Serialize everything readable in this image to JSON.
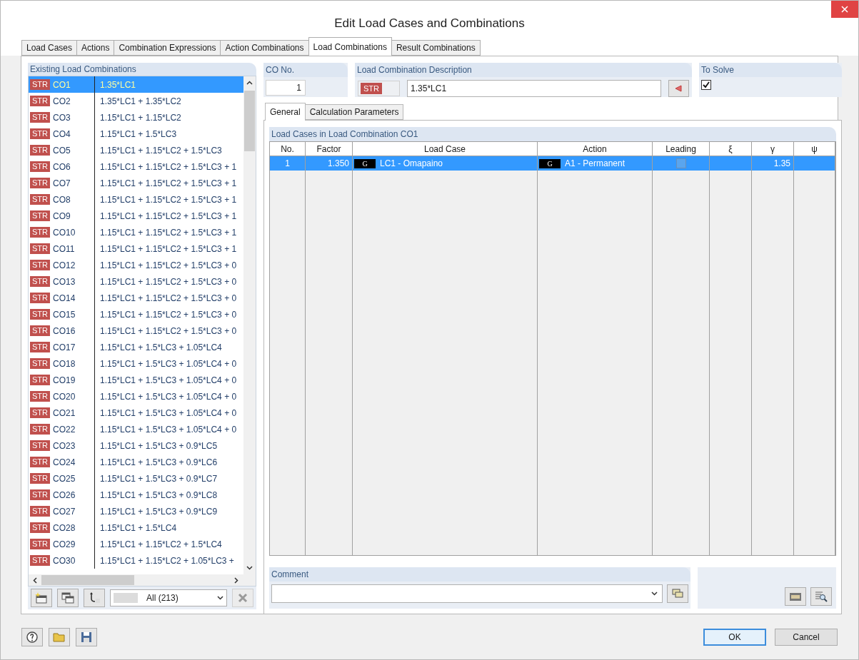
{
  "window": {
    "title": "Edit Load Cases and Combinations"
  },
  "tabs": [
    {
      "label": "Load Cases",
      "selected": false
    },
    {
      "label": "Actions",
      "selected": false
    },
    {
      "label": "Combination Expressions",
      "selected": false
    },
    {
      "label": "Action Combinations",
      "selected": false
    },
    {
      "label": "Load Combinations",
      "selected": true
    },
    {
      "label": "Result Combinations",
      "selected": false
    }
  ],
  "combination_list": {
    "title": "Existing Load Combinations",
    "items": [
      {
        "badge": "STR",
        "name": "CO1",
        "expression": "1.35*LC1",
        "selected": true
      },
      {
        "badge": "STR",
        "name": "CO2",
        "expression": "1.35*LC1 + 1.35*LC2",
        "selected": false
      },
      {
        "badge": "STR",
        "name": "CO3",
        "expression": "1.15*LC1 + 1.15*LC2",
        "selected": false
      },
      {
        "badge": "STR",
        "name": "CO4",
        "expression": "1.15*LC1 + 1.5*LC3",
        "selected": false
      },
      {
        "badge": "STR",
        "name": "CO5",
        "expression": "1.15*LC1 + 1.15*LC2 + 1.5*LC3",
        "selected": false
      },
      {
        "badge": "STR",
        "name": "CO6",
        "expression": "1.15*LC1 + 1.15*LC2 + 1.5*LC3 + 1",
        "selected": false
      },
      {
        "badge": "STR",
        "name": "CO7",
        "expression": "1.15*LC1 + 1.15*LC2 + 1.5*LC3 + 1",
        "selected": false
      },
      {
        "badge": "STR",
        "name": "CO8",
        "expression": "1.15*LC1 + 1.15*LC2 + 1.5*LC3 + 1",
        "selected": false
      },
      {
        "badge": "STR",
        "name": "CO9",
        "expression": "1.15*LC1 + 1.15*LC2 + 1.5*LC3 + 1",
        "selected": false
      },
      {
        "badge": "STR",
        "name": "CO10",
        "expression": "1.15*LC1 + 1.15*LC2 + 1.5*LC3 + 1",
        "selected": false
      },
      {
        "badge": "STR",
        "name": "CO11",
        "expression": "1.15*LC1 + 1.15*LC2 + 1.5*LC3 + 1",
        "selected": false
      },
      {
        "badge": "STR",
        "name": "CO12",
        "expression": "1.15*LC1 + 1.15*LC2 + 1.5*LC3 + 0",
        "selected": false
      },
      {
        "badge": "STR",
        "name": "CO13",
        "expression": "1.15*LC1 + 1.15*LC2 + 1.5*LC3 + 0",
        "selected": false
      },
      {
        "badge": "STR",
        "name": "CO14",
        "expression": "1.15*LC1 + 1.15*LC2 + 1.5*LC3 + 0",
        "selected": false
      },
      {
        "badge": "STR",
        "name": "CO15",
        "expression": "1.15*LC1 + 1.15*LC2 + 1.5*LC3 + 0",
        "selected": false
      },
      {
        "badge": "STR",
        "name": "CO16",
        "expression": "1.15*LC1 + 1.15*LC2 + 1.5*LC3 + 0",
        "selected": false
      },
      {
        "badge": "STR",
        "name": "CO17",
        "expression": "1.15*LC1 + 1.5*LC3 + 1.05*LC4",
        "selected": false
      },
      {
        "badge": "STR",
        "name": "CO18",
        "expression": "1.15*LC1 + 1.5*LC3 + 1.05*LC4 + 0",
        "selected": false
      },
      {
        "badge": "STR",
        "name": "CO19",
        "expression": "1.15*LC1 + 1.5*LC3 + 1.05*LC4 + 0",
        "selected": false
      },
      {
        "badge": "STR",
        "name": "CO20",
        "expression": "1.15*LC1 + 1.5*LC3 + 1.05*LC4 + 0",
        "selected": false
      },
      {
        "badge": "STR",
        "name": "CO21",
        "expression": "1.15*LC1 + 1.5*LC3 + 1.05*LC4 + 0",
        "selected": false
      },
      {
        "badge": "STR",
        "name": "CO22",
        "expression": "1.15*LC1 + 1.5*LC3 + 1.05*LC4 + 0",
        "selected": false
      },
      {
        "badge": "STR",
        "name": "CO23",
        "expression": "1.15*LC1 + 1.5*LC3 + 0.9*LC5",
        "selected": false
      },
      {
        "badge": "STR",
        "name": "CO24",
        "expression": "1.15*LC1 + 1.5*LC3 + 0.9*LC6",
        "selected": false
      },
      {
        "badge": "STR",
        "name": "CO25",
        "expression": "1.15*LC1 + 1.5*LC3 + 0.9*LC7",
        "selected": false
      },
      {
        "badge": "STR",
        "name": "CO26",
        "expression": "1.15*LC1 + 1.5*LC3 + 0.9*LC8",
        "selected": false
      },
      {
        "badge": "STR",
        "name": "CO27",
        "expression": "1.15*LC1 + 1.5*LC3 + 0.9*LC9",
        "selected": false
      },
      {
        "badge": "STR",
        "name": "CO28",
        "expression": "1.15*LC1 + 1.5*LC4",
        "selected": false
      },
      {
        "badge": "STR",
        "name": "CO29",
        "expression": "1.15*LC1 + 1.15*LC2 + 1.5*LC4",
        "selected": false
      },
      {
        "badge": "STR",
        "name": "CO30",
        "expression": "1.15*LC1 + 1.15*LC2 + 1.05*LC3 +",
        "selected": false
      }
    ],
    "filter": {
      "value": "All (213)"
    }
  },
  "co_no": {
    "label": "CO No.",
    "value": "1"
  },
  "description": {
    "label": "Load Combination Description",
    "badge": "STR",
    "value": "1.35*LC1"
  },
  "to_solve": {
    "label": "To Solve",
    "checked": true
  },
  "subtabs": [
    {
      "label": "General",
      "selected": true
    },
    {
      "label": "Calculation Parameters",
      "selected": false
    }
  ],
  "load_case_table": {
    "title": "Load Cases in Load Combination CO1",
    "columns": [
      "No.",
      "Factor",
      "Load Case",
      "Action",
      "Leading",
      "ξ",
      "γ",
      "ψ"
    ],
    "rows": [
      {
        "no": "1",
        "factor": "1.350",
        "load_case_badge": "G",
        "load_case": "LC1 - Omapaino",
        "action_badge": "G",
        "action": "A1 - Permanent",
        "leading": false,
        "gamma": "1.35",
        "selected": true
      }
    ]
  },
  "comment": {
    "label": "Comment"
  },
  "buttons": [
    {
      "label": "OK",
      "default": true
    },
    {
      "label": "Cancel",
      "default": false
    }
  ]
}
